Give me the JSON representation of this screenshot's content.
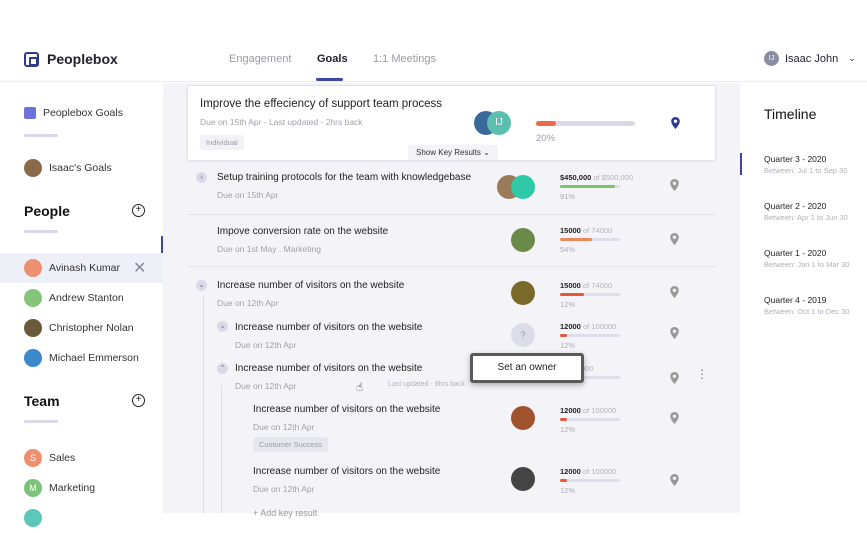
{
  "app": {
    "name": "Peoplebox"
  },
  "nav": {
    "tabs": [
      {
        "label": "Engagement"
      },
      {
        "label": "Goals",
        "active": true
      },
      {
        "label": "1:1 Meetings"
      }
    ]
  },
  "user": {
    "name": "Isaac John",
    "initials": "IJ"
  },
  "sidebar": {
    "links": [
      {
        "label": "Peoplebox Goals"
      },
      {
        "label": "Isaac's Goals"
      }
    ],
    "people_title": "People",
    "people": [
      {
        "name": "Avinash Kumar",
        "selected": true
      },
      {
        "name": "Andrew Stanton"
      },
      {
        "name": "Christopher Nolan"
      },
      {
        "name": "Michael Emmerson"
      }
    ],
    "team_title": "Team",
    "teams": [
      {
        "name": "Sales",
        "initial": "S",
        "color": "#ee9070"
      },
      {
        "name": "Marketing",
        "initial": "M",
        "color": "#7cc37a"
      }
    ]
  },
  "goal": {
    "title": "Improve the effeciency of support team process",
    "subtitle": "Due on 15th Apr - Last updated - 2hrs back",
    "tag": "Individual",
    "owner_initials": "IJ",
    "progress_pct": 20,
    "progress_label": "20%",
    "show_key_results": "Show Key Results"
  },
  "key_results": [
    {
      "title": "Setup training protocols for the team with knowledgebase",
      "subtitle": "Due on 15th Apr",
      "current": "$450,000",
      "target": "of $500,000",
      "pct": 91,
      "pct_label": "91%",
      "color": "#7cc36a"
    },
    {
      "title": "Impove conversion rate on the website",
      "subtitle": "Due on 1st May . Marketing",
      "current": "15000",
      "target": "of 74000",
      "pct": 54,
      "pct_label": "54%",
      "color": "#ea8a5a"
    },
    {
      "title": "Increase number of visitors on the website",
      "subtitle": "Due on 12th Apr",
      "current": "15000",
      "target": "of 74000",
      "pct": 40,
      "pct_label": "12%",
      "color": "#e8573a"
    },
    {
      "title": "Increase number of visitors on the website",
      "subtitle": "Due on 12th Apr",
      "current": "12000",
      "target": "of 100000",
      "pct": 12,
      "pct_label": "12%",
      "color": "#e8573a",
      "owner": "?"
    },
    {
      "title": "Increase number of visitors on the website",
      "subtitle": "Due on 12th Apr",
      "last_updated": "Last updated - 8hrs back",
      "current": "",
      "target": "of 100000",
      "pct": 12,
      "pct_label": "12%",
      "color": "#e8573a"
    },
    {
      "title": "Increase number of visitors on the website",
      "subtitle": "Due on 12th Apr",
      "tag": "Customer Success",
      "current": "12000",
      "target": "of 100000",
      "pct": 12,
      "pct_label": "12%",
      "color": "#e8573a"
    },
    {
      "title": "Increase number of visitors on the website",
      "subtitle": "Due on 12th Apr",
      "current": "12000",
      "target": "of 100000",
      "pct": 12,
      "pct_label": "12%",
      "color": "#e8573a"
    }
  ],
  "tooltip": "Set an owner",
  "add_key_result": "+ Add key result",
  "timeline": {
    "title": "Timeline",
    "quarters": [
      {
        "label": "Quarter 3 - 2020",
        "range": "Between: Jul 1 to Sep 30",
        "active": true
      },
      {
        "label": "Quarter 2 - 2020",
        "range": "Between: Apr 1 to Jun 30"
      },
      {
        "label": "Quarter 1 - 2020",
        "range": "Between: Jan 1 to Mar 30"
      },
      {
        "label": "Quarter 4 - 2019",
        "range": "Between: Oct 1 to Dec 30"
      }
    ]
  }
}
